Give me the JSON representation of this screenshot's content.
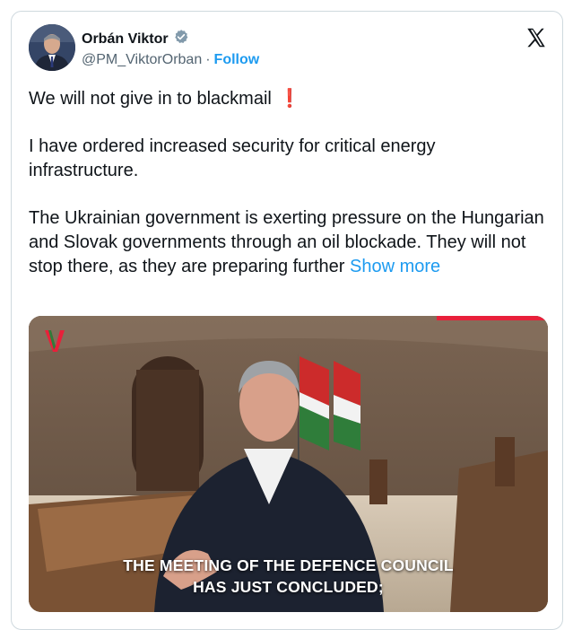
{
  "author": {
    "name": "Orbán Viktor",
    "handle": "@PM_ViktorOrban",
    "separator": "·",
    "follow_label": "Follow"
  },
  "tweet": {
    "line1": "We will not give in to blackmail",
    "line1_emoji": "❗",
    "para2": "I have ordered increased security for critical energy infrastructure.",
    "para3": "The Ukrainian government is exerting pressure on the Hungarian and Slovak governments through an oil blockade. They will not stop there, as they are preparing further",
    "show_more": "Show more"
  },
  "media": {
    "subtitle_line1": "THE MEETING OF THE DEFENCE COUNCIL",
    "subtitle_line2": "HAS JUST CONCLUDED;"
  },
  "colors": {
    "accent": "#1d9bf0",
    "text": "#0f1419",
    "muted": "#536471",
    "border": "#cfd9de",
    "alert": "#e0245e"
  },
  "icons": [
    "verified-badge-icon",
    "x-logo-icon",
    "channel-logo-icon"
  ]
}
